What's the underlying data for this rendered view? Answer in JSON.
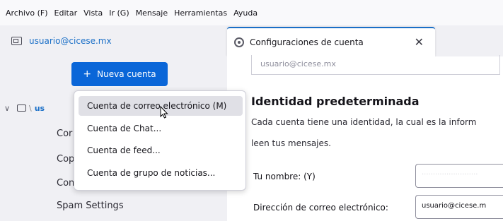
{
  "menubar": {
    "items": [
      "Archivo (F)",
      "Editar",
      "Vista",
      "Ir (G)",
      "Mensaje",
      "Herramientas",
      "Ayuda"
    ]
  },
  "account_tab": {
    "label": "usuario@cicese.mx",
    "icon": "mailbox-icon"
  },
  "settings_tab": {
    "title": "Configuraciones de cuenta",
    "close": "✕",
    "icon": "gear-icon"
  },
  "sidebar": {
    "new_account_button": {
      "plus": "+",
      "label": "Nueva cuenta"
    },
    "account_row": {
      "chevron": "∨",
      "separator": "\\",
      "name": "us"
    },
    "items": [
      "Cor",
      "Cop",
      "Con",
      "Spam Settings"
    ]
  },
  "popup": {
    "items": [
      "Cuenta de correo electrónico (M)",
      "Cuenta de Chat...",
      "Cuenta de feed...",
      "Cuenta de grupo de noticias..."
    ]
  },
  "content": {
    "top_email": "usuario@cicese.mx",
    "identity_heading": "Identidad predeterminada",
    "desc_line1": "Cada cuenta tiene una identidad, la cual es la inform",
    "desc_line2": "leen tus mensajes.",
    "name_label": "Tu nombre: (Y)",
    "email_label": "Dirección de correo electrónico:",
    "email_value": "usuario@cicese.m"
  },
  "colors": {
    "accent": "#0a66d8",
    "link": "#1a6fc7"
  }
}
